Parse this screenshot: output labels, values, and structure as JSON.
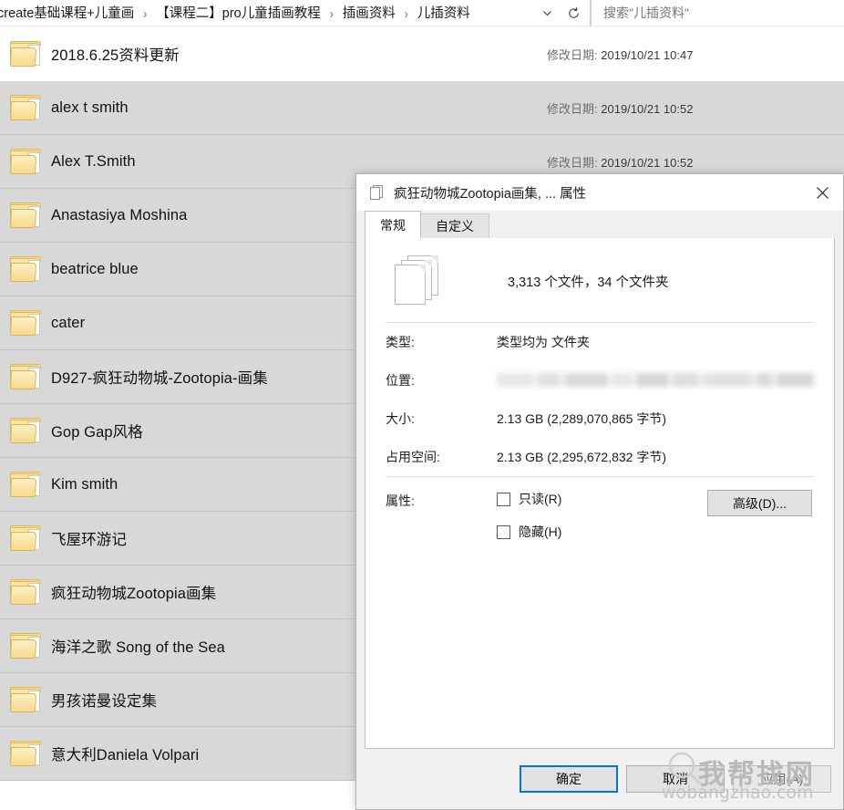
{
  "explorer": {
    "address": {
      "breadcrumbs": [
        "create基础课程+儿童画",
        "【课程二】pro儿童插画教程",
        "插画资料",
        "儿插资料"
      ],
      "separator": "›",
      "dropdown_icon": "chevron-down-icon",
      "refresh_icon": "refresh-icon"
    },
    "search": {
      "placeholder": "搜索\"儿插资料\"",
      "value": ""
    },
    "columns": {
      "date_label": "修改日期:"
    },
    "rows": [
      {
        "name": "2018.6.25资料更新",
        "date": "2019/10/21 10:47",
        "selected": false,
        "icon": "folder-icon"
      },
      {
        "name": "alex t smith",
        "date": "2019/10/21 10:52",
        "selected": true,
        "icon": "folder-icon"
      },
      {
        "name": "Alex T.Smith",
        "date": "2019/10/21 10:52",
        "selected": true,
        "icon": "folder-icon"
      },
      {
        "name": "Anastasiya Moshina",
        "date": "",
        "selected": true,
        "icon": "folder-icon"
      },
      {
        "name": "beatrice blue",
        "date": "",
        "selected": true,
        "icon": "folder-icon"
      },
      {
        "name": "cater",
        "date": "",
        "selected": true,
        "icon": "folder-icon"
      },
      {
        "name": "D927-疯狂动物城-Zootopia-画集",
        "date": "",
        "selected": true,
        "icon": "folder-icon"
      },
      {
        "name": "Gop Gap风格",
        "date": "",
        "selected": true,
        "icon": "folder-icon"
      },
      {
        "name": "Kim smith",
        "date": "",
        "selected": true,
        "icon": "folder-icon"
      },
      {
        "name": "飞屋环游记",
        "date": "",
        "selected": true,
        "icon": "folder-icon"
      },
      {
        "name": "疯狂动物城Zootopia画集",
        "date": "",
        "selected": true,
        "icon": "folder-icon"
      },
      {
        "name": "海洋之歌 Song of the Sea",
        "date": "",
        "selected": true,
        "icon": "folder-icon"
      },
      {
        "name": "男孩诺曼设定集",
        "date": "",
        "selected": true,
        "icon": "folder-icon"
      },
      {
        "name": "意大利Daniela Volpari",
        "date": "",
        "selected": true,
        "icon": "folder-icon"
      }
    ]
  },
  "dialog": {
    "title": "疯狂动物城Zootopia画集, ... 属性",
    "title_icon": "multi-file-icon",
    "close_icon": "close-icon",
    "tabs": [
      {
        "label": "常规",
        "active": true
      },
      {
        "label": "自定义",
        "active": false
      }
    ],
    "summary": "3,313 个文件，34 个文件夹",
    "fields": [
      {
        "label": "类型:",
        "value": "类型均为 文件夹",
        "blurred": false
      },
      {
        "label": "位置:",
        "value": "",
        "blurred": true
      },
      {
        "label": "大小:",
        "value": "2.13 GB (2,289,070,865 字节)",
        "blurred": false
      },
      {
        "label": "占用空间:",
        "value": "2.13 GB (2,295,672,832 字节)",
        "blurred": false
      }
    ],
    "attributes": {
      "label": "属性:",
      "checkboxes": [
        {
          "label": "只读(R)",
          "checked": false
        },
        {
          "label": "隐藏(H)",
          "checked": false
        }
      ],
      "advanced_button": "高级(D)..."
    },
    "buttons": [
      {
        "label": "确定",
        "style": "default"
      },
      {
        "label": "取消",
        "style": "normal"
      },
      {
        "label": "应用(A)",
        "style": "disabled"
      }
    ]
  },
  "watermark": {
    "cn": "我帮找网",
    "en": "wobangzhao.com",
    "icon": "magnifier-icon"
  }
}
